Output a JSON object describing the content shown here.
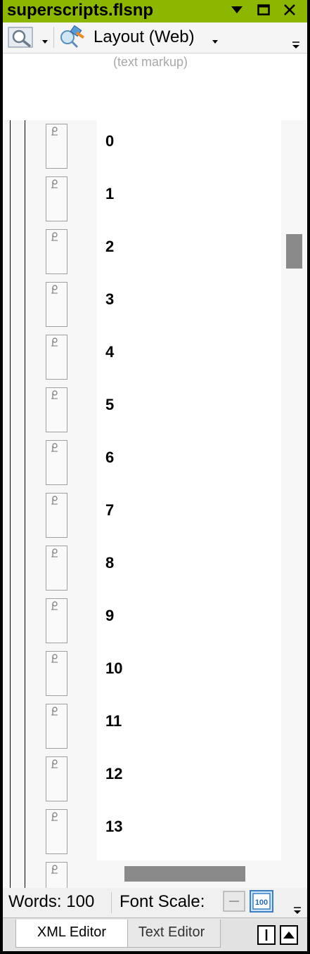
{
  "window": {
    "title": "superscripts.flsnp"
  },
  "toolbar": {
    "zoom_icon": "magnifier-icon",
    "layout_icon": "layout-brush-icon",
    "layout_label": "Layout (Web)"
  },
  "markup": {
    "note": "(text markup)"
  },
  "rows": [
    {
      "tag": "p",
      "text": "0"
    },
    {
      "tag": "p",
      "text": "1"
    },
    {
      "tag": "p",
      "text": "2"
    },
    {
      "tag": "p",
      "text": "3"
    },
    {
      "tag": "p",
      "text": "4"
    },
    {
      "tag": "p",
      "text": "5"
    },
    {
      "tag": "p",
      "text": "6"
    },
    {
      "tag": "p",
      "text": "7"
    },
    {
      "tag": "p",
      "text": "8"
    },
    {
      "tag": "p",
      "text": "9"
    },
    {
      "tag": "p",
      "text": "10"
    },
    {
      "tag": "p",
      "text": "11"
    },
    {
      "tag": "p",
      "text": "12"
    },
    {
      "tag": "p",
      "text": "13"
    }
  ],
  "status": {
    "words": "Words: 100",
    "font_scale_label": "Font Scale:",
    "scale_100_label": "100"
  },
  "tabs": [
    {
      "label": "XML Editor",
      "active": true
    },
    {
      "label": "Text Editor",
      "active": false
    }
  ],
  "colors": {
    "title_bar": "#8db600",
    "scroll_thumb": "#8a8a8a"
  }
}
